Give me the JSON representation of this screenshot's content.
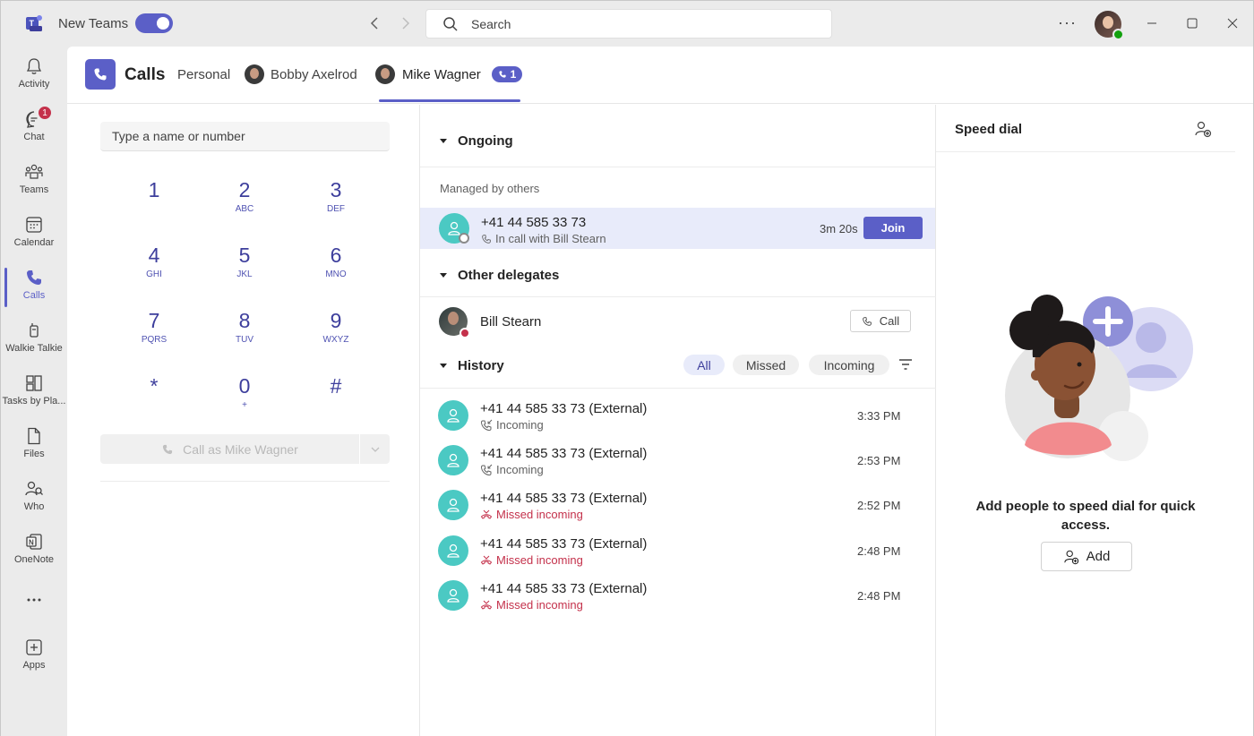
{
  "titlebar": {
    "app_name": "New Teams",
    "search_placeholder": "Search",
    "toggle_on": true
  },
  "rail": {
    "items": [
      {
        "label": "Activity",
        "icon": "bell-icon"
      },
      {
        "label": "Chat",
        "icon": "chat-icon",
        "badge": "1"
      },
      {
        "label": "Teams",
        "icon": "teams-icon"
      },
      {
        "label": "Calendar",
        "icon": "calendar-icon"
      },
      {
        "label": "Calls",
        "icon": "phone-icon",
        "active": true
      },
      {
        "label": "Walkie Talkie",
        "icon": "walkie-talkie-icon"
      },
      {
        "label": "Tasks by Pla...",
        "icon": "tasks-icon"
      },
      {
        "label": "Files",
        "icon": "file-icon"
      },
      {
        "label": "Who",
        "icon": "who-icon"
      },
      {
        "label": "OneNote",
        "icon": "onenote-icon"
      },
      {
        "label": "",
        "icon": "more-icon"
      },
      {
        "label": "Apps",
        "icon": "apps-icon"
      }
    ]
  },
  "header": {
    "title": "Calls",
    "tabs": [
      {
        "label": "Personal"
      },
      {
        "label": "Bobby Axelrod"
      },
      {
        "label": "Mike Wagner",
        "active": true,
        "badge": "1"
      }
    ]
  },
  "dialpad": {
    "placeholder": "Type a name or number",
    "keys": [
      {
        "num": "1",
        "sub": ""
      },
      {
        "num": "2",
        "sub": "ABC"
      },
      {
        "num": "3",
        "sub": "DEF"
      },
      {
        "num": "4",
        "sub": "GHI"
      },
      {
        "num": "5",
        "sub": "JKL"
      },
      {
        "num": "6",
        "sub": "MNO"
      },
      {
        "num": "7",
        "sub": "PQRS"
      },
      {
        "num": "8",
        "sub": "TUV"
      },
      {
        "num": "9",
        "sub": "WXYZ"
      },
      {
        "num": "*",
        "sub": ""
      },
      {
        "num": "0",
        "sub": "+"
      },
      {
        "num": "#",
        "sub": ""
      }
    ],
    "call_button": "Call as Mike Wagner"
  },
  "ongoing": {
    "heading": "Ongoing",
    "managed_label": "Managed by others",
    "call": {
      "number": "+41 44 585 33 73",
      "status": "In call with Bill Stearn",
      "duration": "3m 20s",
      "join_label": "Join"
    }
  },
  "delegates": {
    "heading": "Other delegates",
    "items": [
      {
        "name": "Bill Stearn",
        "call_label": "Call"
      }
    ]
  },
  "history": {
    "heading": "History",
    "filters": [
      {
        "label": "All",
        "active": true
      },
      {
        "label": "Missed"
      },
      {
        "label": "Incoming"
      }
    ],
    "items": [
      {
        "number": "+41 44 585 33 73 (External)",
        "type": "Incoming",
        "time": "3:33 PM",
        "missed": false
      },
      {
        "number": "+41 44 585 33 73 (External)",
        "type": "Incoming",
        "time": "2:53 PM",
        "missed": false
      },
      {
        "number": "+41 44 585 33 73 (External)",
        "type": "Missed incoming",
        "time": "2:52 PM",
        "missed": true
      },
      {
        "number": "+41 44 585 33 73 (External)",
        "type": "Missed incoming",
        "time": "2:48 PM",
        "missed": true
      },
      {
        "number": "+41 44 585 33 73 (External)",
        "type": "Missed incoming",
        "time": "2:48 PM",
        "missed": true
      }
    ]
  },
  "speed_dial": {
    "title": "Speed dial",
    "message": "Add people to speed dial for quick access.",
    "add_label": "Add"
  },
  "colors": {
    "brand": "#5b5fc7",
    "teal": "#4bc9c3",
    "missed": "#c4314b",
    "ongoing_bg": "#e8ebfa"
  }
}
